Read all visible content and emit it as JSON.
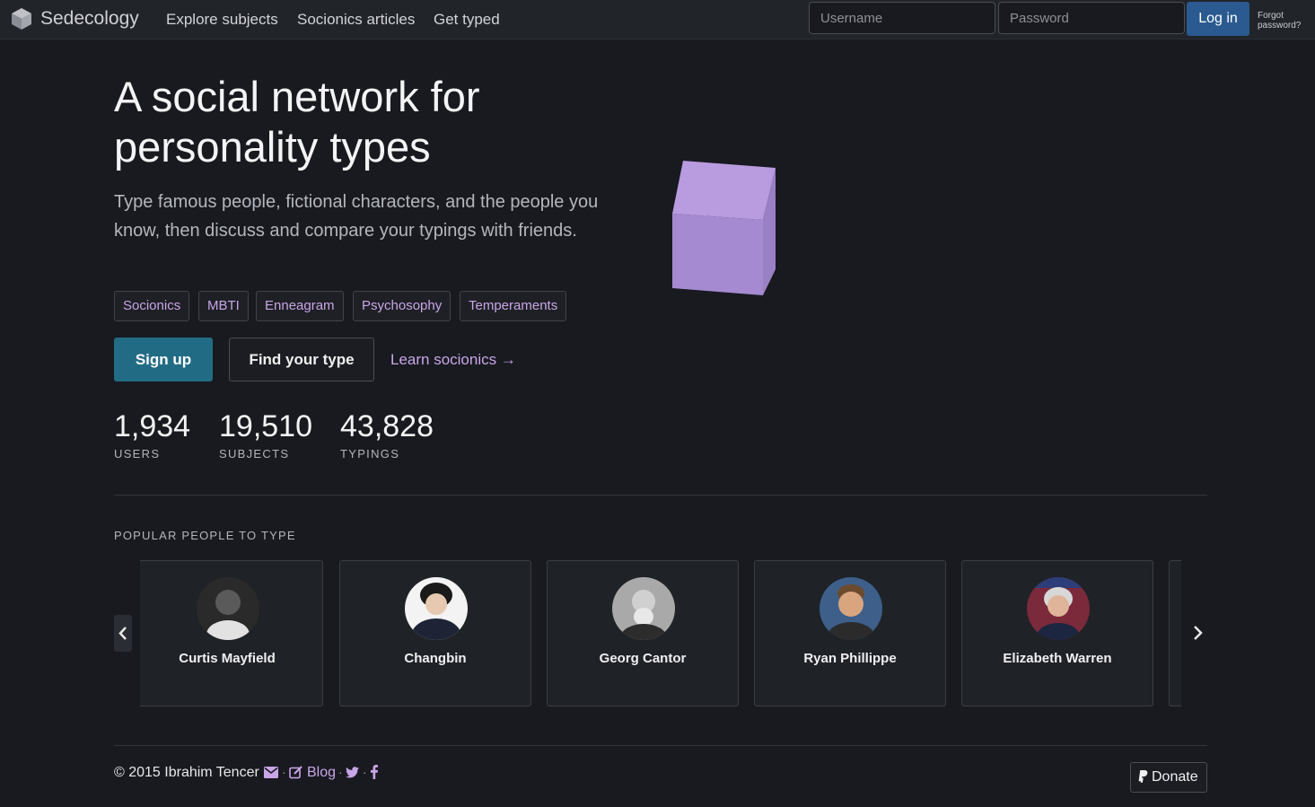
{
  "nav": {
    "brand": "Sedecology",
    "links": [
      "Explore subjects",
      "Socionics articles",
      "Get typed"
    ],
    "username_placeholder": "Username",
    "password_placeholder": "Password",
    "login_label": "Log in",
    "forgot_line1": "Forgot",
    "forgot_line2": "password?"
  },
  "hero": {
    "title_line1": "A social network for",
    "title_line2": "personality types",
    "description": "Type famous people, fictional characters, and the people you know, then discuss and compare your typings with friends.",
    "tags": [
      "Socionics",
      "MBTI",
      "Enneagram",
      "Psychosophy",
      "Temperaments"
    ],
    "signup_label": "Sign up",
    "find_type_label": "Find your type",
    "learn_label": "Learn socionics →"
  },
  "stats": [
    {
      "value": "1,934",
      "label": "USERS"
    },
    {
      "value": "19,510",
      "label": "SUBJECTS"
    },
    {
      "value": "43,828",
      "label": "TYPINGS"
    }
  ],
  "popular": {
    "heading": "POPULAR PEOPLE TO TYPE",
    "people": [
      {
        "name": "Curtis Mayfield"
      },
      {
        "name": "Changbin"
      },
      {
        "name": "Georg Cantor"
      },
      {
        "name": "Ryan Phillippe"
      },
      {
        "name": "Elizabeth Warren"
      }
    ]
  },
  "footer": {
    "copyright": "© 2015 Ibrahim Tencer",
    "blog_label": "Blog",
    "separator": "·",
    "donate_label": "Donate"
  },
  "colors": {
    "background": "#181a1f",
    "navbar": "#212429",
    "accent_purple": "#c9a5e8",
    "signup_teal": "#226b85",
    "login_blue": "#2a5a8f",
    "cube_top": "#b99be0",
    "cube_front": "#a58ad2"
  }
}
